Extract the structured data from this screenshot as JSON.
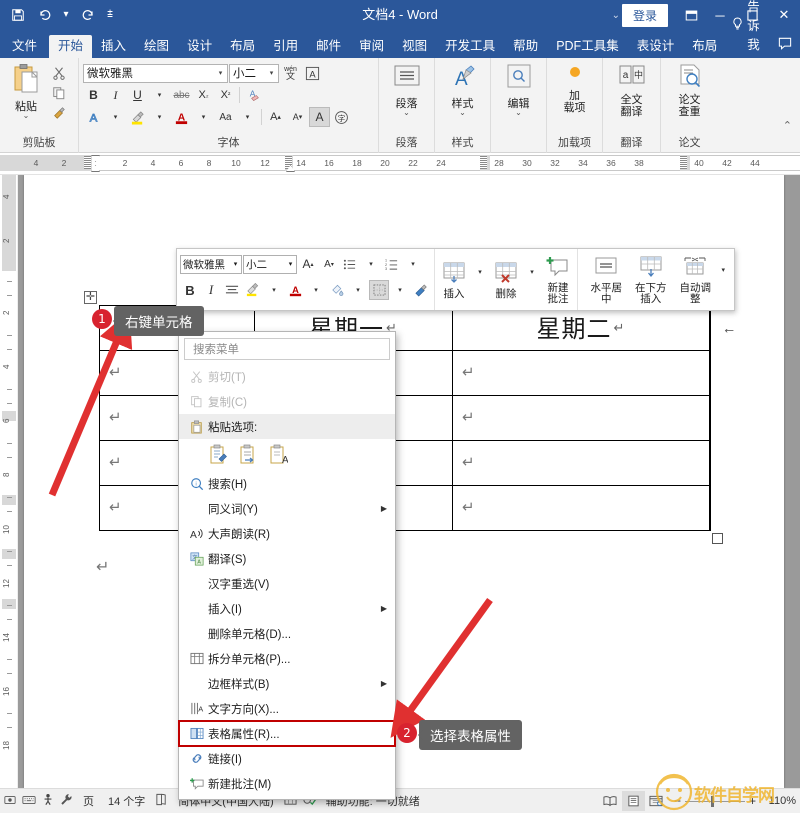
{
  "titlebar": {
    "title": "文档4  -  Word",
    "qat": [
      {
        "name": "save-button",
        "glyph": "Ὃe"
      },
      {
        "name": "undo-button",
        "glyph": "↶"
      },
      {
        "name": "redo-button",
        "glyph": "↻"
      },
      {
        "name": "customize-qat-button",
        "glyph": "⌄"
      }
    ],
    "signin_label": "登录",
    "ribbon_display_glyph": "❐",
    "minimize_glyph": "─",
    "maximize_glyph": "☐",
    "close_glyph": "✕"
  },
  "tabs": [
    {
      "label": "文件",
      "active": false,
      "file": true
    },
    {
      "label": "开始",
      "active": true
    },
    {
      "label": "插入",
      "active": false
    },
    {
      "label": "绘图",
      "active": false
    },
    {
      "label": "设计",
      "active": false
    },
    {
      "label": "布局",
      "active": false
    },
    {
      "label": "引用",
      "active": false
    },
    {
      "label": "邮件",
      "active": false
    },
    {
      "label": "审阅",
      "active": false
    },
    {
      "label": "视图",
      "active": false
    },
    {
      "label": "开发工具",
      "active": false
    },
    {
      "label": "帮助",
      "active": false
    },
    {
      "label": "PDF工具集",
      "active": false
    },
    {
      "label": "表设计",
      "active": false
    },
    {
      "label": "布局",
      "active": false
    }
  ],
  "tellme": {
    "label": "告诉我",
    "icon": "lightbulb-icon"
  },
  "share": {
    "icon": "comment-icon"
  },
  "ribbon": {
    "groups": [
      {
        "name": "clipboard",
        "label": "剪贴板",
        "paste": {
          "label": "粘贴",
          "caret": "⌄"
        },
        "items": [
          {
            "label": "剪切",
            "glyph": "✂"
          },
          {
            "label": "复制",
            "glyph": "⧉"
          },
          {
            "label": "格式刷",
            "glyph": "὘C"
          }
        ],
        "launcher": "⤵"
      },
      {
        "name": "font",
        "label": "字体",
        "font_name": "微软雅黑",
        "font_size": "小二",
        "pinyin_label": "wén",
        "row1": [
          "B",
          "I",
          "U",
          "⌄",
          "abc",
          "X₂",
          "X²",
          "A"
        ],
        "row2": [
          "A",
          "⌄",
          "ab",
          "⌄",
          "A",
          "⌄",
          "Aa",
          "⌄",
          "A↑",
          "A↓",
          "A",
          "字"
        ],
        "launcher": "⤵"
      },
      {
        "name": "paragraph",
        "label": "段落",
        "button": "段落",
        "caret": "⌄"
      },
      {
        "name": "styles",
        "label": "样式",
        "button": "样式",
        "caret": "⌄",
        "launcher": "⤵"
      },
      {
        "name": "editing",
        "label": "",
        "button": "编辑",
        "caret": "⌄"
      },
      {
        "name": "addins",
        "label": "加载项",
        "button": "加\n载项"
      },
      {
        "name": "translate",
        "label": "翻译",
        "button": "全文\n翻译"
      },
      {
        "name": "thesis",
        "label": "论文",
        "button": "论文\n查重"
      }
    ],
    "collapse_glyph": "⌃"
  },
  "ruler": {
    "horizontal_numbers": [
      "4",
      "2",
      "2",
      "4",
      "6",
      "8",
      "10",
      "12",
      "14",
      "16",
      "18",
      "20",
      "22",
      "24",
      "28",
      "30",
      "32",
      "34",
      "36",
      "38",
      "40",
      "42",
      "44"
    ],
    "vertical_numbers": [
      "4",
      "2",
      "2",
      "4",
      "6",
      "8",
      "10",
      "12",
      "14",
      "16",
      "18",
      "20"
    ]
  },
  "document": {
    "table": {
      "rows": [
        {
          "cells": [
            {
              "text": "",
              "pmark": ""
            },
            {
              "text": "星期一",
              "pmark": "↵"
            },
            {
              "text": "星期二",
              "pmark": "↵"
            }
          ]
        },
        {
          "cells": [
            {
              "text": "",
              "pmark": "↵"
            },
            {
              "text": "",
              "pmark": "↵"
            },
            {
              "text": "",
              "pmark": "↵"
            }
          ]
        },
        {
          "cells": [
            {
              "text": "",
              "pmark": "↵"
            },
            {
              "text": "",
              "pmark": "↵"
            },
            {
              "text": "",
              "pmark": "↵"
            }
          ]
        },
        {
          "cells": [
            {
              "text": "",
              "pmark": "↵"
            },
            {
              "text": "",
              "pmark": "↵"
            },
            {
              "text": "",
              "pmark": "↵"
            }
          ]
        },
        {
          "cells": [
            {
              "text": "",
              "pmark": "↵"
            },
            {
              "text": "",
              "pmark": "↵"
            },
            {
              "text": "",
              "pmark": "↵"
            }
          ]
        }
      ],
      "row_end_mark": "←",
      "move_handle": "✛",
      "final_paragraph_mark": "↵"
    }
  },
  "mini_toolbar": {
    "font_name": "微软雅黑",
    "font_size": "小二",
    "grow_font": "A↑",
    "shrink_font": "A↓",
    "bullets": "☰",
    "numbering": "≡",
    "bold": "B",
    "italic": "I",
    "align": "☰",
    "highlight": "ab",
    "font_color": "A",
    "shading": "◇",
    "borders": "▦",
    "format_painter": "὘C",
    "buttons": [
      {
        "name": "insert",
        "label": "插入",
        "glyph": "table-insert-icon",
        "caret": true
      },
      {
        "name": "delete",
        "label": "删除",
        "glyph": "table-delete-icon",
        "caret": true
      },
      {
        "name": "new-comment",
        "label": "新建\n批注",
        "glyph": "comment-plus-icon",
        "caret": false
      },
      {
        "name": "center-horizontal",
        "label": "水平居中",
        "glyph": "align-center-icon",
        "caret": false
      },
      {
        "name": "insert-below",
        "label": "在下方插入",
        "glyph": "insert-below-icon",
        "caret": false
      },
      {
        "name": "autofit",
        "label": "自动调整",
        "glyph": "autofit-icon",
        "caret": true
      }
    ]
  },
  "context_menu": {
    "search_placeholder": "搜索菜单",
    "items": [
      {
        "label": "剪切(T)",
        "icon": "scissors-icon",
        "disabled": true,
        "arrow": false
      },
      {
        "label": "复制(C)",
        "icon": "copy-icon",
        "disabled": true,
        "arrow": false
      },
      {
        "label": "粘贴选项:",
        "icon": "paste-icon",
        "disabled": false,
        "arrow": false,
        "header": true
      },
      {
        "label": "搜索(H)",
        "icon": "search-icon",
        "disabled": false,
        "arrow": false
      },
      {
        "label": "同义词(Y)",
        "icon": "",
        "disabled": false,
        "arrow": true
      },
      {
        "label": "大声朗读(R)",
        "icon": "read-aloud-icon",
        "disabled": false,
        "arrow": false
      },
      {
        "label": "翻译(S)",
        "icon": "translate-icon",
        "disabled": false,
        "arrow": false
      },
      {
        "label": "汉字重选(V)",
        "icon": "",
        "disabled": false,
        "arrow": false
      },
      {
        "label": "插入(I)",
        "icon": "",
        "disabled": false,
        "arrow": true
      },
      {
        "label": "删除单元格(D)...",
        "icon": "",
        "disabled": false,
        "arrow": false
      },
      {
        "label": "拆分单元格(P)...",
        "icon": "split-cells-icon",
        "disabled": false,
        "arrow": false
      },
      {
        "label": "边框样式(B)",
        "icon": "",
        "disabled": false,
        "arrow": true
      },
      {
        "label": "文字方向(X)...",
        "icon": "text-direction-icon",
        "disabled": false,
        "arrow": false
      },
      {
        "label": "表格属性(R)...",
        "icon": "table-properties-icon",
        "disabled": false,
        "arrow": false,
        "highlight": true
      },
      {
        "label": "链接(I)",
        "icon": "link-icon",
        "disabled": false,
        "arrow": false
      },
      {
        "label": "新建批注(M)",
        "icon": "new-comment-icon",
        "disabled": false,
        "arrow": false
      }
    ],
    "paste_options": [
      "paste-keep-formatting-icon",
      "paste-merge-icon",
      "paste-text-only-icon"
    ]
  },
  "annotations": [
    {
      "number": "1",
      "label": "右键单元格"
    },
    {
      "number": "2",
      "label": "选择表格属性"
    }
  ],
  "statusbar": {
    "left_icons": [
      "record-macro-icon",
      "keyboard-icon",
      "accessibility-icon",
      "tools-icon"
    ],
    "page_label": "页",
    "word_count": "14 个字",
    "spellcheck_icon": "proofing-icon",
    "language": "简体中文(中国大陆)",
    "language_icon": "ime-icon",
    "accessibility": "辅助功能: 一切就绪",
    "view_buttons": [
      "read-mode-icon",
      "print-layout-icon",
      "web-layout-icon"
    ],
    "zoom_out": "−",
    "zoom_in": "+",
    "zoom_level": "110%"
  }
}
